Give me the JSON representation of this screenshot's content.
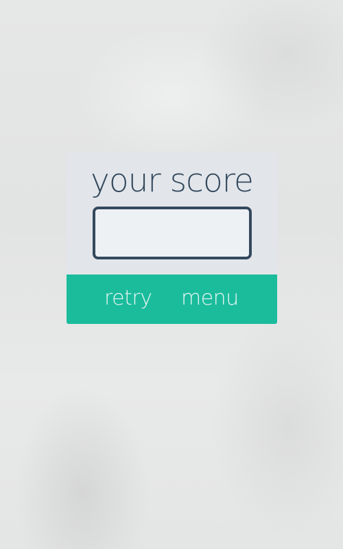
{
  "score_panel": {
    "title": "your score",
    "score_value": "",
    "colors": {
      "panel": "#e2e6ea",
      "text": "#34495e",
      "box_fill": "#edf1f4",
      "button_bar": "#1abc9c"
    }
  },
  "actions": {
    "retry_label": "retry",
    "menu_label": "menu"
  }
}
